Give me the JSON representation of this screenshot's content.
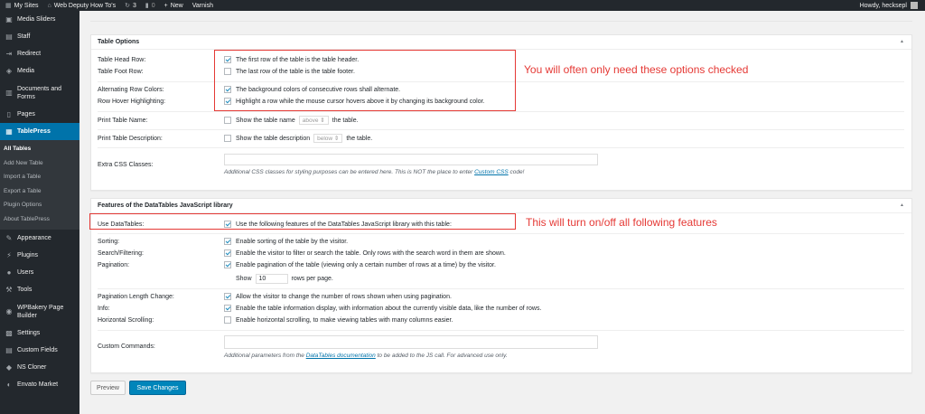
{
  "admin_bar": {
    "my_sites": "My Sites",
    "site_name": "Web Deputy How To's",
    "updates_count": "3",
    "comments_count": "0",
    "new_label": "New",
    "varnish_label": "Varnish",
    "howdy": "Howdy, hecksepl"
  },
  "sidebar": {
    "items": [
      {
        "label": "Media Sliders",
        "icon": "slides-icon"
      },
      {
        "label": "Staff",
        "icon": "staff-icon"
      },
      {
        "label": "Redirect",
        "icon": "redirect-icon"
      },
      {
        "label": "Media",
        "icon": "media-icon"
      },
      {
        "label": "Documents and Forms",
        "icon": "documents-icon"
      },
      {
        "label": "Pages",
        "icon": "pages-icon"
      },
      {
        "label": "TablePress",
        "icon": "table-icon"
      }
    ],
    "submenu": [
      "All Tables",
      "Add New Table",
      "Import a Table",
      "Export a Table",
      "Plugin Options",
      "About TablePress"
    ],
    "items_after": [
      {
        "label": "Appearance",
        "icon": "brush-icon"
      },
      {
        "label": "Plugins",
        "icon": "plugin-icon"
      },
      {
        "label": "Users",
        "icon": "users-icon"
      },
      {
        "label": "Tools",
        "icon": "tools-icon"
      },
      {
        "label": "WPBakery Page Builder",
        "icon": "builder-icon"
      },
      {
        "label": "Settings",
        "icon": "settings-icon"
      },
      {
        "label": "Custom Fields",
        "icon": "fields-icon"
      },
      {
        "label": "NS Cloner",
        "icon": "cloner-icon"
      },
      {
        "label": "Envato Market",
        "icon": "envato-icon"
      }
    ]
  },
  "table_options": {
    "title": "Table Options",
    "head_row_label": "Table Head Row:",
    "head_row_text": "The first row of the table is the table header.",
    "foot_row_label": "Table Foot Row:",
    "foot_row_text": "The last row of the table is the table footer.",
    "alt_colors_label": "Alternating Row Colors:",
    "alt_colors_text": "The background colors of consecutive rows shall alternate.",
    "hover_label": "Row Hover Highlighting:",
    "hover_text": "Highlight a row while the mouse cursor hovers above it by changing its background color.",
    "print_name_label": "Print Table Name:",
    "print_name_pre": "Show the table name",
    "print_name_select": "above",
    "print_name_post": "the table.",
    "print_desc_label": "Print Table Description:",
    "print_desc_pre": "Show the table description",
    "print_desc_select": "below",
    "print_desc_post": "the table.",
    "css_label": "Extra CSS Classes:",
    "css_help_pre": "Additional CSS classes for styling purposes can be entered here. This is NOT the place to enter ",
    "css_help_link": "Custom CSS",
    "css_help_post": " code!"
  },
  "datatables": {
    "title": "Features of the DataTables JavaScript library",
    "use_label": "Use DataTables:",
    "use_text": "Use the following features of the DataTables JavaScript library with this table:",
    "sorting_label": "Sorting:",
    "sorting_text": "Enable sorting of the table by the visitor.",
    "search_label": "Search/Filtering:",
    "search_text": "Enable the visitor to filter or search the table. Only rows with the search word in them are shown.",
    "pagination_label": "Pagination:",
    "pagination_text": "Enable pagination of the table (viewing only a certain number of rows at a time) by the visitor.",
    "show_label": "Show",
    "rows_value": "10",
    "rows_label": "rows per page.",
    "length_label": "Pagination Length Change:",
    "length_text": "Allow the visitor to change the number of rows shown when using pagination.",
    "info_label": "Info:",
    "info_text": "Enable the table information display, with information about the currently visible data, like the number of rows.",
    "hscroll_label": "Horizontal Scrolling:",
    "hscroll_text": "Enable horizontal scrolling, to make viewing tables with many columns easier.",
    "commands_label": "Custom Commands:",
    "commands_help_pre": "Additional parameters from the ",
    "commands_help_link": "DataTables documentation",
    "commands_help_post": " to be added to the JS call. For advanced use only."
  },
  "annotations": {
    "options_note": "You will often only need these options checked",
    "datatables_note": "This will turn on/off all following features"
  },
  "buttons": {
    "preview": "Preview",
    "save": "Save Changes"
  },
  "colors": {
    "accent": "#0073aa",
    "annotation": "#e53935",
    "sidebar": "#23282d"
  }
}
